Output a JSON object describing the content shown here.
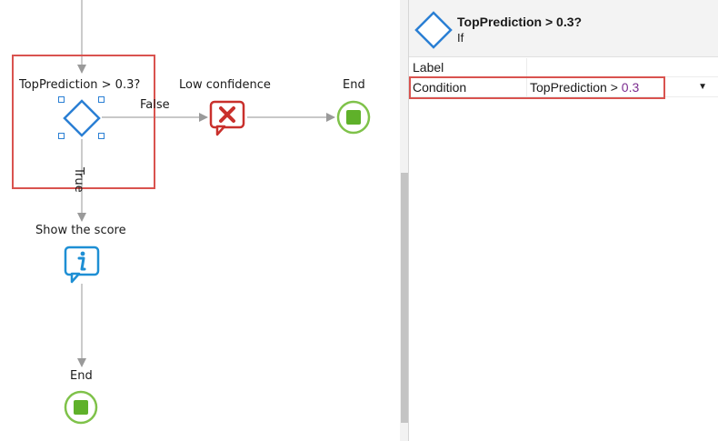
{
  "flow": {
    "if_node_label": "TopPrediction > 0.3?",
    "false_label": "False",
    "true_label": "True",
    "low_confidence_label": "Low confidence",
    "end_label_right": "End",
    "show_score_label": "Show the score",
    "end_label_bottom": "End"
  },
  "props": {
    "title": "TopPrediction > 0.3?",
    "subtitle": "If",
    "rows": [
      {
        "name": "Label",
        "value": ""
      },
      {
        "name": "Condition",
        "value_prefix": "TopPrediction > ",
        "value_number": "0.3"
      }
    ]
  },
  "colors": {
    "selection_red": "#d9534f",
    "diamond_blue": "#2a7fd4",
    "error_red": "#c9302c",
    "info_blue": "#1e8fd4",
    "end_green": "#6bbf2f",
    "number_purple": "#7b2c8f"
  },
  "icons": [
    "if-diamond-icon",
    "error-bubble-icon",
    "info-bubble-icon",
    "end-circle-icon",
    "dropdown-arrow-icon"
  ]
}
